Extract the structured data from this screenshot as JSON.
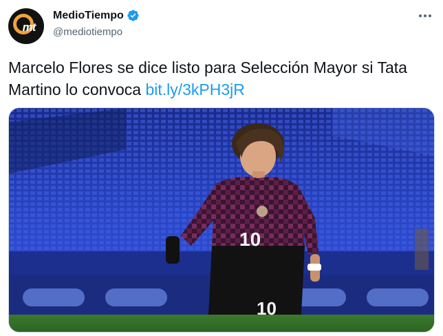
{
  "author": {
    "display_name": "MedioTiempo",
    "handle": "@mediotiempo",
    "avatar_logo_text": "mt",
    "verified": true
  },
  "tweet": {
    "text": "Marcelo Flores se dice listo para Selección Mayor si Tata Martino lo convoca ",
    "link": "bit.ly/3kPH3jR"
  },
  "media": {
    "jersey_number": "10"
  },
  "icons": {
    "verified": "verified-badge-icon",
    "more": "more-options-icon"
  },
  "colors": {
    "link": "#1d9bf0",
    "verified": "#1d9bf0",
    "handle": "#536471"
  }
}
